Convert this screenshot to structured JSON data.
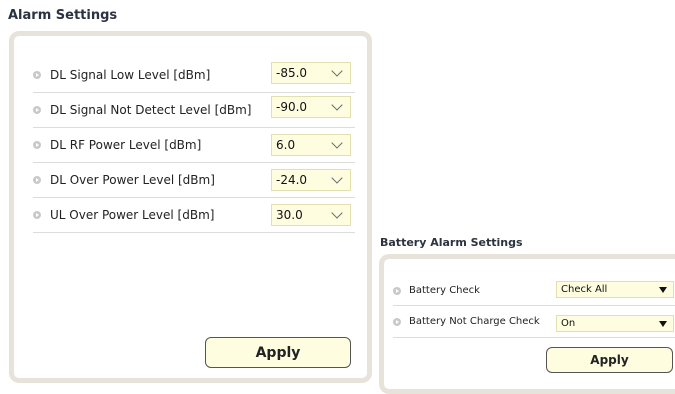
{
  "alarm": {
    "title": "Alarm Settings",
    "rows": [
      {
        "label": "DL Signal Low Level [dBm]",
        "value": "-85.0"
      },
      {
        "label": "DL Signal Not Detect Level [dBm]",
        "value": "-90.0"
      },
      {
        "label": "DL RF Power Level [dBm]",
        "value": "6.0"
      },
      {
        "label": "DL Over Power Level [dBm]",
        "value": "-24.0"
      },
      {
        "label": "UL Over Power Level [dBm]",
        "value": "30.0"
      }
    ],
    "apply_label": "Apply"
  },
  "battery": {
    "title": "Battery Alarm Settings",
    "rows": [
      {
        "label": "Battery Check",
        "value": "Check All"
      },
      {
        "label": "Battery Not Charge Check",
        "value": "On"
      }
    ],
    "apply_label": "Apply"
  },
  "colors": {
    "field_background": "#fffde0",
    "panel_border": "#e8e3da",
    "title_text": "#2b3340"
  },
  "icons": {
    "row_bullet": "bullet-arrow-icon",
    "dropdown_alarm": "chevron-down-icon",
    "dropdown_battery": "triangle-down-icon"
  }
}
